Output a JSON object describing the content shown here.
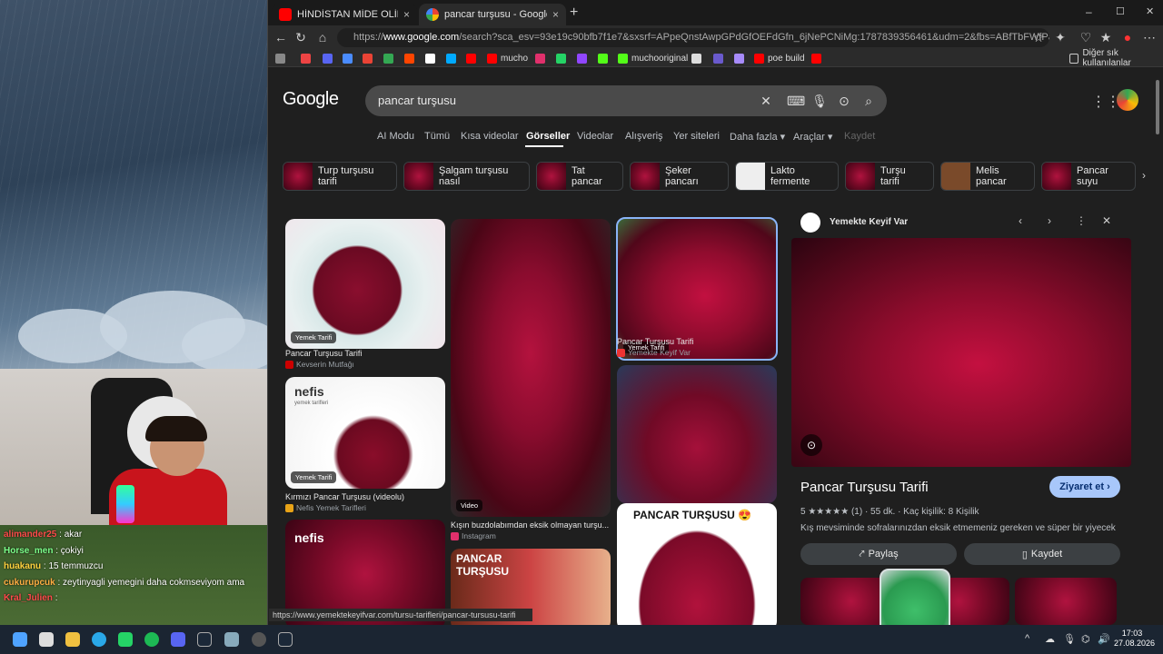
{
  "tabs": [
    {
      "label": "HİNDİSTAN MİDE OLİMPİYATLARI",
      "close": "×",
      "active": false
    },
    {
      "label": "pancar turşusu - Google'da Ara",
      "close": "×",
      "active": true
    }
  ],
  "new_tab": "+",
  "window_controls": {
    "min": "–",
    "max": "☐",
    "close": "✕"
  },
  "url": {
    "prefix": "https://",
    "domain": "www.google.com",
    "rest": "/search?sca_esv=93e19c90bfb7f1e7&sxsrf=APpeQnstAwpGPdGfOEFdGfn_6jNePCNiMg:1787839356461&udm=2&fbs=ABfTbFWfPazdQeYYSro3Hgtr2dR..."
  },
  "bookmarks": [
    {
      "label": "",
      "color": "#888"
    },
    {
      "label": "",
      "color": "#e44"
    },
    {
      "label": "",
      "color": "#5865f2"
    },
    {
      "label": "",
      "color": "#4a8cff"
    },
    {
      "label": "",
      "color": "#ea4335"
    },
    {
      "label": "",
      "color": "#34a853"
    },
    {
      "label": "",
      "color": "#ff4500"
    },
    {
      "label": "",
      "color": "#fff"
    },
    {
      "label": "",
      "color": "#0af"
    },
    {
      "label": "",
      "color": "#f00"
    },
    {
      "label": "mucho",
      "color": "#f00"
    },
    {
      "label": "",
      "color": "#e1306c"
    },
    {
      "label": "",
      "color": "#25d366"
    },
    {
      "label": "",
      "color": "#9146ff"
    },
    {
      "label": "",
      "color": "#53fc18"
    },
    {
      "label": "muchooriginal",
      "color": "#53fc18"
    },
    {
      "label": "",
      "color": "#ddd"
    },
    {
      "label": "",
      "color": "#6a5acd"
    },
    {
      "label": "",
      "color": "#a78bfa"
    },
    {
      "label": "poe build",
      "color": "#f00"
    },
    {
      "label": "",
      "color": "#f00"
    }
  ],
  "other_bookmarks": "Diğer sık kullanılanlar",
  "google": {
    "logo": "Google",
    "query": "pancar turşusu",
    "nav_tabs": [
      "AI Modu",
      "Tümü",
      "Kısa videolar",
      "Görseller",
      "Videolar",
      "Alışveriş",
      "Yer siteleri",
      "Daha fazla ▾",
      "Araçlar ▾",
      "Kaydet"
    ],
    "chips": [
      "Turp turşusu tarifi",
      "Şalgam turşusu nasıl",
      "Tat pancar",
      "Şeker pancarı",
      "Lakto fermente",
      "Turşu tarifi",
      "Melis pancar",
      "Pancar suyu"
    ],
    "results": [
      {
        "title": "Pancar Turşusu Tarifi",
        "source": "Kevserin Mutfağı",
        "badge": "Yemek Tarifi"
      },
      {
        "title": "Kırmızı Pancar Turşusu (videolu)",
        "source": "Nefis Yemek Tarifleri",
        "badge": "Yemek Tarifi"
      },
      {
        "title": "Kışın buzdolabımdan eksik olmayan turşu...",
        "source": "Instagram",
        "badge": "Video"
      },
      {
        "title": "Pancar Turşusu Tarifi",
        "source": "Yemekte Keyif Var",
        "badge": "Yemek Tarifi"
      }
    ],
    "overlay_texts": {
      "nefis": "nefis",
      "nefis_sub": "yemek tarifleri",
      "pancar_tursusu": "PANCAR TURŞUSU 😍",
      "pancar_small": "PANCAR TURŞUSU"
    },
    "tooltip": "https://www.yemektekeyifvar.com/tursu-tarifleri/pancar-tursusu-tarifi"
  },
  "panel": {
    "source": "Yemekte Keyif Var",
    "title": "Pancar Turşusu Tarifi",
    "visit": "Ziyaret et ›",
    "rating": "5 ★★★★★ (1) · 55 dk. · Kaç kişilik: 8 Kişilik",
    "description": "Kış mevsiminde sofralarınızdan eksik etmemeniz gereken ve süper bir yiyecek ola...",
    "share": "Paylaş",
    "save": "Kaydet"
  },
  "chat": [
    {
      "user": "alimander25",
      "msg": ": akar",
      "color": "#ff4b4b"
    },
    {
      "user": "Horse_men",
      "msg": ": çokiyi",
      "color": "#7cff8a"
    },
    {
      "user": "huakanu",
      "msg": ": 15 temmuzcu",
      "color": "#ffd23f"
    },
    {
      "user": "cukurupcuk",
      "msg": ": zeytinyagli yemegini daha cokmseviyom ama",
      "color": "#ffae42"
    },
    {
      "user": "Kral_Julien",
      "msg": ":",
      "color": "#ff4b4b"
    }
  ],
  "clock": {
    "time": "17:03",
    "date": "27.08.2026"
  }
}
